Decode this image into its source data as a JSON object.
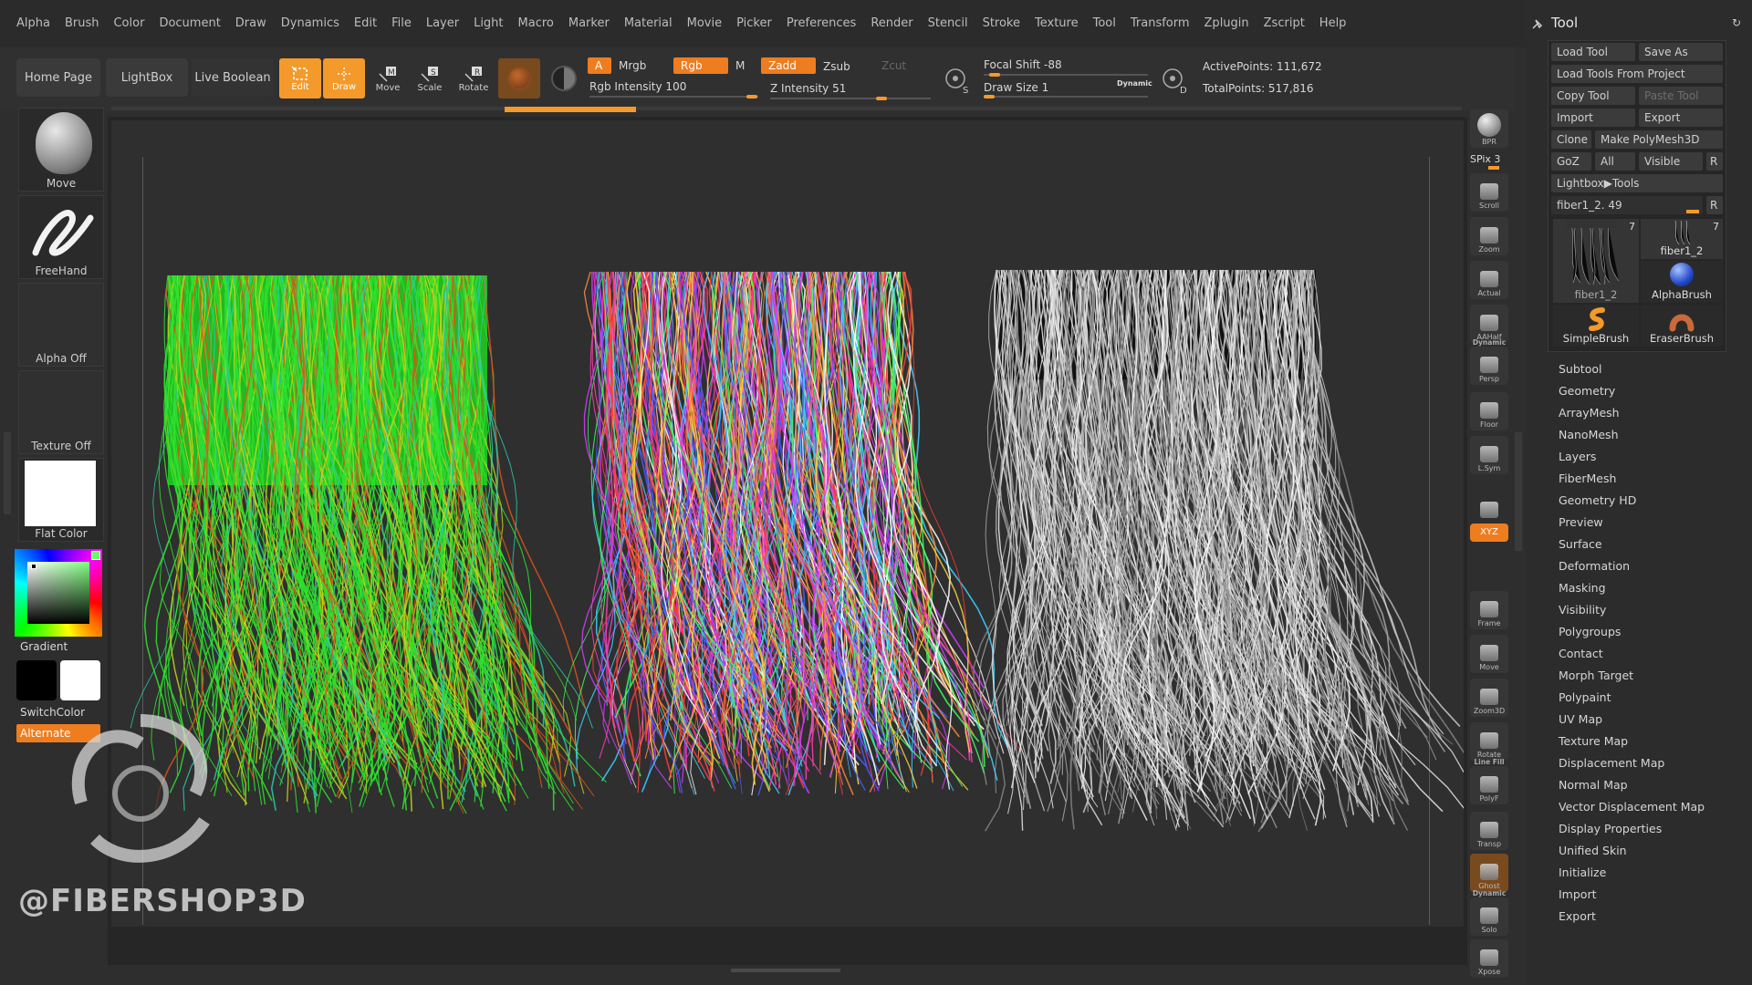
{
  "menu": [
    "Alpha",
    "Brush",
    "Color",
    "Document",
    "Draw",
    "Dynamics",
    "Edit",
    "File",
    "Layer",
    "Light",
    "Macro",
    "Marker",
    "Material",
    "Movie",
    "Picker",
    "Preferences",
    "Render",
    "Stencil",
    "Stroke",
    "Texture",
    "Tool",
    "Transform",
    "Zplugin",
    "Zscript",
    "Help"
  ],
  "toolbar": {
    "home_page": "Home Page",
    "lightbox": "LightBox",
    "live_boolean": "Live Boolean",
    "edit": "Edit",
    "draw": "Draw",
    "move": "Move",
    "scale": "Scale",
    "rotate": "Rotate",
    "a_label": "A",
    "mrgb": "Mrgb",
    "rgb": "Rgb",
    "m": "M",
    "rgb_intensity": "Rgb Intensity 100",
    "zadd": "Zadd",
    "zsub": "Zsub",
    "zcut": "Zcut",
    "z_intensity": "Z Intensity 51",
    "focal_shift": "Focal Shift -88",
    "draw_size": "Draw Size 1",
    "dynamic": "Dynamic",
    "s_label": "S",
    "d_label": "D",
    "active_points": "ActivePoints: 111,672",
    "total_points": "TotalPoints: 517,816"
  },
  "left_panel": {
    "move": "Move",
    "freehand": "FreeHand",
    "alpha_off": "Alpha Off",
    "texture_off": "Texture Off",
    "flat_color": "Flat Color",
    "gradient": "Gradient",
    "switch_color": "SwitchColor",
    "alternate": "Alternate"
  },
  "watermark": "@FIBERSHOP3D",
  "right_strip": [
    {
      "icon": "bpr-icon",
      "label": "BPR"
    },
    {
      "icon": "spix-slider",
      "label": "SPix 3"
    },
    {
      "icon": "scroll-icon",
      "label": "Scroll"
    },
    {
      "icon": "zoom-icon",
      "label": "Zoom"
    },
    {
      "icon": "actual-icon",
      "label": "Actual"
    },
    {
      "icon": "aahalf-icon",
      "label": "AAHalf"
    },
    {
      "icon": "persp-icon",
      "label": "Persp",
      "top": "Dynamic"
    },
    {
      "icon": "floor-icon",
      "label": "Floor"
    },
    {
      "icon": "lsym-icon",
      "label": "L.Sym"
    },
    {
      "icon": "lock-icon",
      "label": ""
    },
    {
      "icon": "xyz-icon",
      "label": "XYZ"
    },
    {
      "icon": "frame-icon",
      "label": "Frame"
    },
    {
      "icon": "move-icon",
      "label": "Move"
    },
    {
      "icon": "zoom3d-icon",
      "label": "Zoom3D"
    },
    {
      "icon": "rotate-icon",
      "label": "Rotate"
    },
    {
      "icon": "polyf-icon",
      "label": "PolyF",
      "top": "Line Fill"
    },
    {
      "icon": "transp-icon",
      "label": "Transp"
    },
    {
      "icon": "ghost-icon",
      "label": "Ghost"
    },
    {
      "icon": "solo-icon",
      "label": "Solo",
      "top": "Dynamic"
    },
    {
      "icon": "xpose-icon",
      "label": "Xpose"
    }
  ],
  "tool_panel": {
    "title": "Tool",
    "load_tool": "Load Tool",
    "save_as": "Save As",
    "load_tools_from_project": "Load Tools From Project",
    "copy_tool": "Copy Tool",
    "paste_tool": "Paste Tool",
    "import": "Import",
    "export": "Export",
    "clone": "Clone",
    "make_polymesh": "Make PolyMesh3D",
    "goz": "GoZ",
    "all": "All",
    "visible": "Visible",
    "r": "R",
    "lightbox_tools": "Lightbox▶Tools",
    "current_tool": "fiber1_2. 49",
    "thumbs": [
      {
        "name": "fiber1_2",
        "count": "7"
      },
      {
        "name": "fiber1_2",
        "count": "7"
      },
      {
        "name": "AlphaBrush",
        "count": ""
      },
      {
        "name": "SimpleBrush",
        "count": ""
      },
      {
        "name": "EraserBrush",
        "count": ""
      }
    ],
    "sections": [
      "Subtool",
      "Geometry",
      "ArrayMesh",
      "NanoMesh",
      "Layers",
      "FiberMesh",
      "Geometry HD",
      "Preview",
      "Surface",
      "Deformation",
      "Masking",
      "Visibility",
      "Polygroups",
      "Contact",
      "Morph Target",
      "Polypaint",
      "UV Map",
      "Texture Map",
      "Displacement Map",
      "Normal Map",
      "Vector Displacement Map",
      "Display Properties",
      "Unified Skin",
      "Initialize",
      "Import",
      "Export"
    ]
  },
  "colors": {
    "accent": "#f39a2b",
    "main_color": "#000000",
    "secondary_color": "#ffffff"
  }
}
